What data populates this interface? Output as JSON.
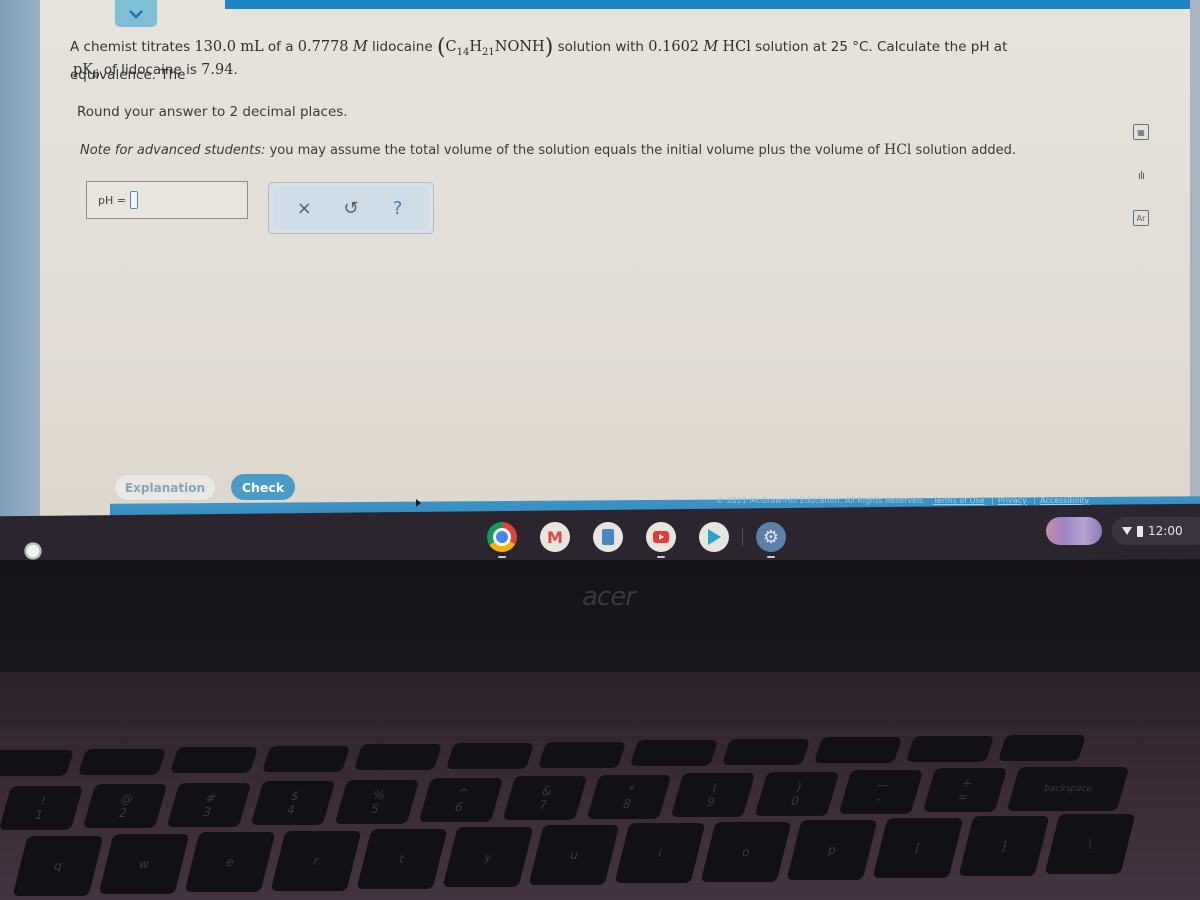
{
  "question": {
    "intro": "A chemist titrates",
    "volume": "130.0",
    "volume_unit": "mL",
    "of_a": "of a",
    "concentration": "0.7778",
    "molar": "M",
    "compound": "lidocaine",
    "formula": {
      "c": "C",
      "c_sub": "14",
      "h": "H",
      "h_sub": "21",
      "rest": "NONH"
    },
    "mid": "solution with",
    "titrant_conc": "0.1602",
    "titrant_molar": "M",
    "titrant": "HCl",
    "tail": "solution at 25 °C. Calculate the pH at equivalence. The",
    "pkb_p": "p",
    "pkb_k": "K",
    "pkb_sub": "b",
    "pkb_text": "of lidocaine is",
    "pkb_value": "7.94",
    "pkb_end": "."
  },
  "instructions": {
    "round": "Round your answer to 2 decimal places.",
    "adv_label": "Note for advanced students:",
    "adv_text": "you may assume the total volume of the solution equals the initial volume plus the volume of",
    "adv_hcl": "HCl",
    "adv_end": "solution added."
  },
  "answer": {
    "label": "pH =",
    "value": ""
  },
  "tools": {
    "clear": "×",
    "undo": "↺",
    "help": "?"
  },
  "side_tools": [
    {
      "icon": "calculator-icon",
      "glyph": "▦"
    },
    {
      "icon": "bar-chart-icon",
      "glyph": "ılı"
    },
    {
      "icon": "periodic-table-icon",
      "glyph": "Ar"
    }
  ],
  "buttons": {
    "explanation": "Explanation",
    "check": "Check"
  },
  "footer": {
    "copyright": "© 2021 McGraw-Hill Education. All Rights Reserved.",
    "terms": "Terms of Use",
    "privacy": "Privacy",
    "accessibility": "Accessibility",
    "sep": "|"
  },
  "shelf": {
    "apps": [
      "Chrome",
      "Gmail",
      "Files",
      "YouTube",
      "Play Store",
      "Settings"
    ],
    "time": "12:00"
  },
  "laptop": {
    "brand": "acer",
    "keys_row1": [
      "!",
      "@",
      "#",
      "$",
      "%",
      "^",
      "&",
      "*",
      "(",
      ")",
      "—",
      "+",
      "backspace"
    ],
    "keys_row1_lower": [
      "1",
      "2",
      "3",
      "4",
      "5",
      "6",
      "7",
      "8",
      "9",
      "0",
      "-",
      "="
    ],
    "keys_row2": [
      "q",
      "w",
      "e",
      "r",
      "t",
      "y",
      "u",
      "i",
      "o",
      "p",
      "[",
      "]",
      "\\"
    ]
  },
  "colors": {
    "accent": "#1c85c4",
    "check_button": "#4a9cc8",
    "footer_bar": "#3d93c4"
  }
}
